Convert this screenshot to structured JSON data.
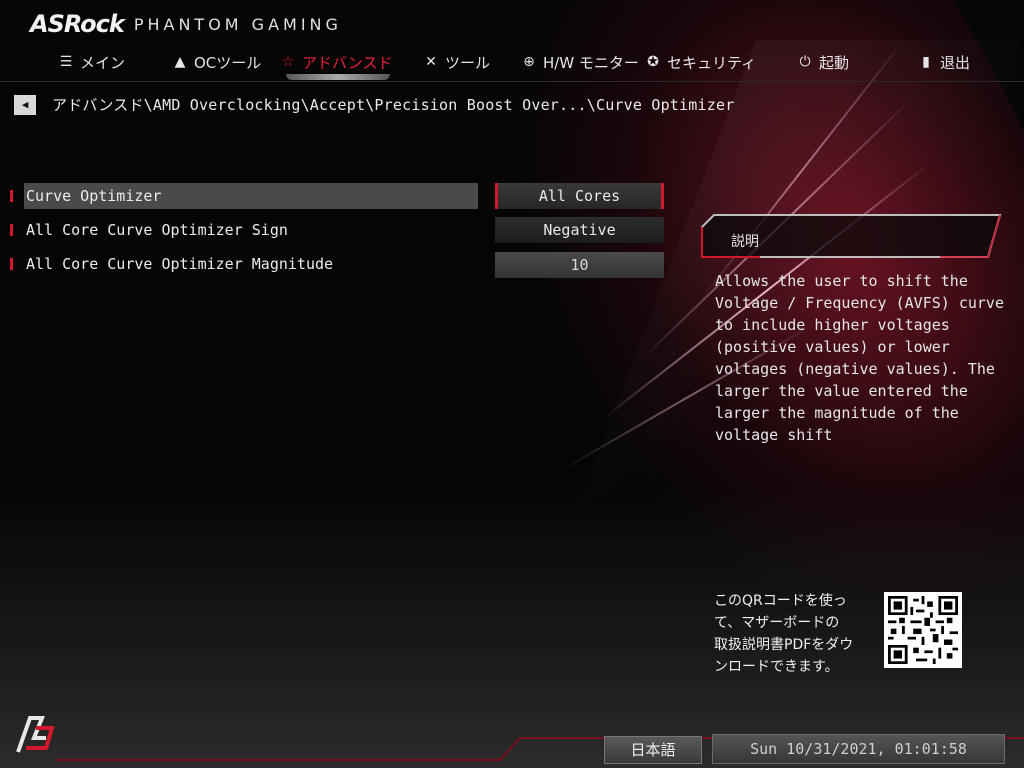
{
  "header": {
    "brand": "ASRock",
    "subbrand": "PHANTOM GAMING"
  },
  "nav": {
    "items": [
      {
        "label": "メイン",
        "icon": "list-icon"
      },
      {
        "label": "OCツール",
        "icon": "rocket-icon"
      },
      {
        "label": "アドバンスド",
        "icon": "star-icon",
        "active": true
      },
      {
        "label": "ツール",
        "icon": "tools-icon"
      },
      {
        "label": "H/W モニター",
        "icon": "target-icon"
      },
      {
        "label": "セキュリティ",
        "icon": "shield-icon"
      },
      {
        "label": "起動",
        "icon": "power-icon"
      },
      {
        "label": "退出",
        "icon": "exit-door-icon"
      }
    ]
  },
  "breadcrumb": {
    "path": "アドバンスド\\AMD Overclocking\\Accept\\Precision Boost Over...\\Curve Optimizer"
  },
  "settings": [
    {
      "label": "Curve Optimizer",
      "value": "All Cores"
    },
    {
      "label": "All Core Curve Optimizer Sign",
      "value": "Negative"
    },
    {
      "label": "All Core Curve Optimizer Magnitude",
      "value": "10"
    }
  ],
  "description": {
    "title": "説明",
    "lines": [
      "Allows the user to shift the",
      "Voltage / Frequency (AVFS) curve",
      "to include higher voltages",
      "(positive values) or lower",
      "voltages (negative values). The",
      "larger the value entered the",
      "larger the magnitude of the",
      "voltage shift"
    ]
  },
  "qr": {
    "lines": [
      "このQRコードを使っ",
      "て、マザーボードの",
      "取扱説明書PDFをダウ",
      "ンロードできます。"
    ]
  },
  "footer": {
    "language": "日本語",
    "datetime": "Sun 10/31/2021, 01:01:58"
  },
  "colors": {
    "accent": "#d3182e",
    "active_tab": "#e8213a"
  }
}
